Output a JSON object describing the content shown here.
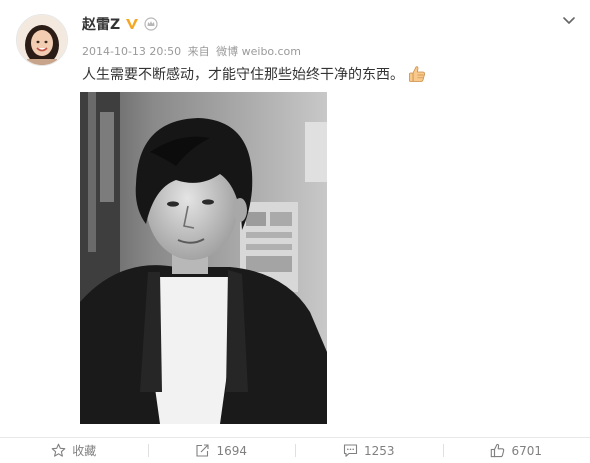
{
  "post": {
    "username": "赵雷Z",
    "date": "2014-10-13 20:50",
    "source_prefix": "来自",
    "source": "微博 weibo.com",
    "text": "人生需要不断感动，才能守住那些始终干净的东西。",
    "verified_badge_color": "#f5a623",
    "photo": {
      "description_icon": "black-and-white-portrait-photo"
    }
  },
  "icons": {
    "avatar": "avatar-image",
    "verified": "verified-v-badge-icon",
    "crown": "member-crown-icon",
    "menu": "chevron-down-icon",
    "emoji": "thumbs-up-emoji-icon",
    "favorite": "star-icon",
    "repost": "repost-icon",
    "comment": "comment-icon",
    "like": "like-thumb-icon"
  },
  "actions": {
    "favorite_label": "收藏",
    "repost_count": "1694",
    "comment_count": "1253",
    "like_count": "6701"
  },
  "colors": {
    "text": "#333333",
    "meta": "#9a9a9a",
    "action": "#808080"
  }
}
